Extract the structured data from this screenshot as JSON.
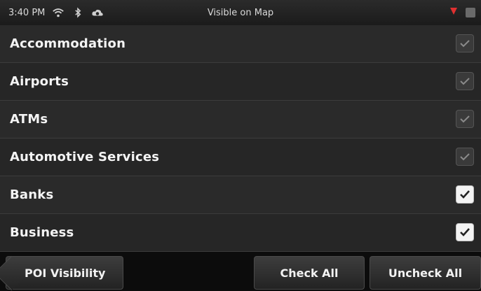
{
  "status": {
    "time": "3:40 PM",
    "title": "Visible on Map",
    "icons": [
      "wifi-icon",
      "bluetooth-icon",
      "cloud-icon",
      "antenna-icon",
      "battery-icon"
    ]
  },
  "list": {
    "items": [
      {
        "label": "Accommodation",
        "checked": true,
        "style": "dim"
      },
      {
        "label": "Airports",
        "checked": true,
        "style": "dim"
      },
      {
        "label": "ATMs",
        "checked": true,
        "style": "dim"
      },
      {
        "label": "Automotive Services",
        "checked": true,
        "style": "dim"
      },
      {
        "label": "Banks",
        "checked": true,
        "style": "bright"
      },
      {
        "label": "Business",
        "checked": true,
        "style": "bright"
      }
    ]
  },
  "toolbar": {
    "back_label": "POI Visibility",
    "check_all_label": "Check All",
    "uncheck_all_label": "Uncheck All"
  },
  "colors": {
    "row_bg": "#2a2a2a",
    "checkbox_dim": "#3a3a3a",
    "checkbox_on": "#f3f3f3",
    "check_dim": "#8a8a8a",
    "check_on": "#222222",
    "antenna_red": "#e03030"
  }
}
